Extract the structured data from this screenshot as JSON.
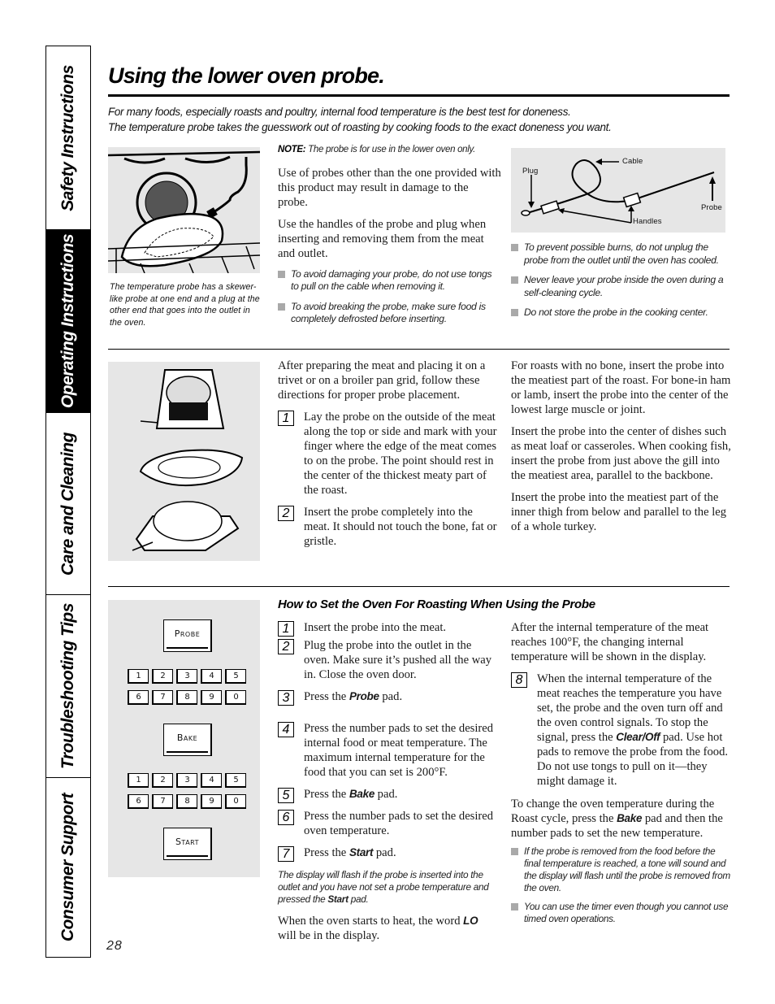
{
  "side_tabs": [
    {
      "label": "Safety Instructions",
      "active": false
    },
    {
      "label": "Operating Instructions",
      "active": true
    },
    {
      "label": "Care and Cleaning",
      "active": false
    },
    {
      "label": "Troubleshooting Tips",
      "active": false
    },
    {
      "label": "Consumer Support",
      "active": false
    }
  ],
  "title": "Using the lower oven probe.",
  "intro": [
    "For many foods, especially roasts and poultry, internal food temperature is the best test for doneness.",
    "The temperature probe takes the guesswork out of roasting by cooking foods to the exact doneness you want."
  ],
  "section1": {
    "image_caption": "The temperature probe has a skewer-like probe at one end and a plug at the other end that goes into the outlet in the oven.",
    "note_label": "NOTE:",
    "note_text": " The probe is for use in the lower oven only.",
    "paragraphs": [
      "Use of probes other than the one provided with this product may result in damage to the probe.",
      "Use the handles of the probe and plug when inserting and removing them from the meat and outlet."
    ],
    "bullets_left": [
      "To avoid damaging your probe, do not use tongs to pull on the cable when removing it.",
      "To avoid breaking the probe, make sure food is completely defrosted before inserting."
    ],
    "diagram_labels": {
      "plug": "Plug",
      "cable": "Cable",
      "handles": "Handles",
      "probe": "Probe"
    },
    "bullets_right": [
      "To prevent possible burns, do not unplug the probe from the outlet until the oven has cooled.",
      "Never leave your probe inside the oven during a self-cleaning cycle.",
      "Do not store the probe in the cooking center."
    ]
  },
  "section2": {
    "intro": "After preparing the meat and placing it on a trivet or on a broiler pan grid, follow these directions for proper probe placement.",
    "steps": [
      {
        "num": "1",
        "text": "Lay the probe on the outside of the meat along the top or side and mark with your finger where the edge of the meat comes to on the probe. The point should rest in the center of the thickest meaty part of the roast."
      },
      {
        "num": "2",
        "text": "Insert the probe completely into the meat. It should not touch the bone, fat or gristle."
      }
    ],
    "right_paragraphs": [
      "For roasts with no bone, insert the probe into the meatiest part of the roast. For bone-in ham or lamb, insert the probe into the center of the lowest large muscle or joint.",
      "Insert the probe into the center of dishes such as meat loaf or casseroles. When cooking fish, insert the probe from just above the gill into the meatiest area, parallel to the backbone.",
      "Insert the probe into the meatiest part of the inner thigh from below and parallel to the leg of a whole turkey."
    ]
  },
  "section3": {
    "heading": "How to Set the Oven For Roasting When Using the Probe",
    "control_panel": {
      "probe_pad": "Probe",
      "bake_pad": "Bake",
      "start_pad": "Start",
      "number_row_1": [
        "1",
        "2",
        "3",
        "4",
        "5"
      ],
      "number_row_2": [
        "6",
        "7",
        "8",
        "9",
        "0"
      ]
    },
    "steps": [
      {
        "num": "1",
        "pre": "Insert the probe into the meat.",
        "bold": "",
        "post": ""
      },
      {
        "num": "2",
        "pre": "Plug the probe into the outlet in the oven. Make sure it’s pushed all the way in. Close the oven door.",
        "bold": "",
        "post": ""
      },
      {
        "num": "3",
        "pre": "Press the ",
        "bold": "Probe",
        "post": " pad."
      },
      {
        "num": "4",
        "pre": "Press the number pads to set the desired internal food or meat temperature. The maximum internal temperature for the food that you can set is 200°F.",
        "bold": "",
        "post": ""
      },
      {
        "num": "5",
        "pre": "Press the ",
        "bold": "Bake",
        "post": " pad."
      },
      {
        "num": "6",
        "pre": "Press the number pads to set the desired oven temperature.",
        "bold": "",
        "post": ""
      },
      {
        "num": "7",
        "pre": "Press the ",
        "bold": "Start",
        "post": " pad."
      }
    ],
    "flash_note_pre": "The display will flash if the probe is inserted into the outlet and you have not set a probe temperature and pressed the ",
    "flash_note_bold": "Start",
    "flash_note_post": " pad.",
    "heat_note_pre": "When the oven starts to heat, the word ",
    "heat_note_bold": "LO",
    "heat_note_post": " will be in the display.",
    "right_intro": "After the internal temperature of the meat reaches 100°F, the changing internal temperature will be shown in the display.",
    "step8": {
      "num": "8",
      "pre": "When the internal temperature of the meat reaches the temperature you have set, the probe and the oven turn off and the oven control signals. To stop the signal, press the ",
      "bold": "Clear/Off",
      "post": " pad. Use hot pads to remove the probe from the food. Do not use tongs to pull on it—they might damage it."
    },
    "change_temp_pre": "To change the oven temperature during the Roast cycle, press the ",
    "change_temp_bold": "Bake",
    "change_temp_post": " pad and then the number pads to set the new temperature.",
    "bullets": [
      "If the probe is removed from the food before the final temperature is reached, a tone will sound and the display will flash until the probe is removed from the oven.",
      "You can use the timer even though you cannot use timed oven operations."
    ]
  },
  "page_number": "28"
}
